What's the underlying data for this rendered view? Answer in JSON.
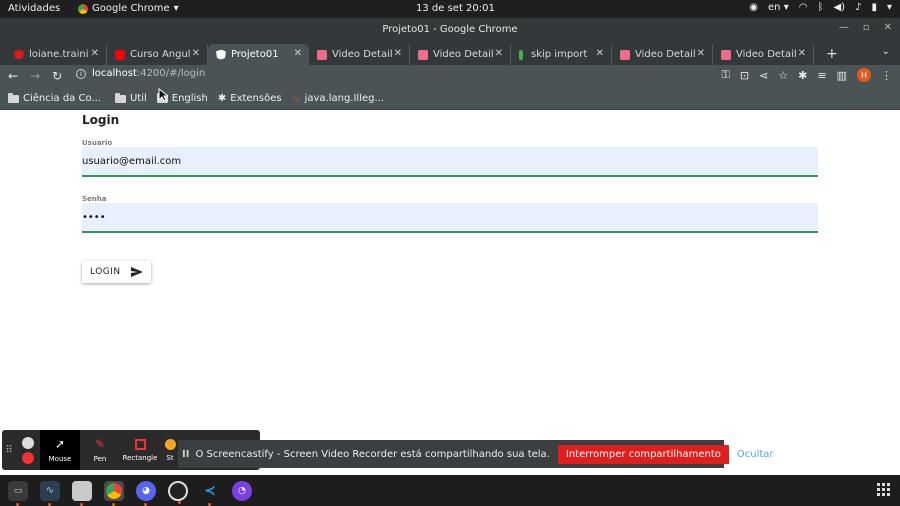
{
  "os_bar": {
    "activities": "Atividades",
    "app_name": "Google Chrome",
    "clock": "13 de set  20:01",
    "lang": "en"
  },
  "window": {
    "title": "Projeto01 - Google Chrome"
  },
  "tabs": [
    {
      "label": "loiane.traini",
      "icon": "angular-icon",
      "color": "#dd1b16",
      "active": false
    },
    {
      "label": "Curso Angul",
      "icon": "youtube-icon",
      "color": "#ff0000",
      "active": false
    },
    {
      "label": "Projeto01",
      "icon": "angular-icon",
      "color": "#ffffff",
      "active": true
    },
    {
      "label": "Video Detail",
      "icon": "video-icon",
      "color": "#f06d8a",
      "active": false
    },
    {
      "label": "Video Detail",
      "icon": "video-icon",
      "color": "#f06d8a",
      "active": false
    },
    {
      "label": "skip import",
      "icon": "sheet-icon",
      "color": "#47b04b",
      "active": false
    },
    {
      "label": "Video Detail",
      "icon": "video-icon",
      "color": "#f06d8a",
      "active": false
    },
    {
      "label": "Video Detail",
      "icon": "video-icon",
      "color": "#f06d8a",
      "active": false
    }
  ],
  "address": {
    "host": "localhost",
    "path": ":4200/#/login"
  },
  "profile_initial": "H",
  "bookmarks": [
    {
      "label": "Ciência da Co...",
      "icon": "folder-icon"
    },
    {
      "label": "Util",
      "icon": "folder-icon"
    },
    {
      "label": "English",
      "icon": "folder-icon"
    },
    {
      "label": "Extensões",
      "icon": "puzzle-icon"
    },
    {
      "label": "java.lang.Illeg...",
      "icon": "java-icon"
    }
  ],
  "page": {
    "title": "Login",
    "username_label": "Usuario",
    "username_value": "usuario@email.com",
    "password_label": "Senha",
    "password_value": "••••",
    "login_button": "LOGIN"
  },
  "screencastify": {
    "tools": [
      {
        "label": "Mouse",
        "selected": true
      },
      {
        "label": "Pen",
        "selected": false
      },
      {
        "label": "Rectangle",
        "selected": false
      },
      {
        "label": "St",
        "selected": false
      }
    ],
    "share_message": "O Screencastify - Screen Video Recorder está compartilhando sua tela.",
    "stop_label": "Interromper compartilhamento",
    "hide_label": "Ocultar"
  },
  "colors": {
    "accent_green": "#2e9a55",
    "field_bg": "#e8f0fe",
    "stop_red": "#e01e1e",
    "profile_orange": "#e8581b"
  }
}
